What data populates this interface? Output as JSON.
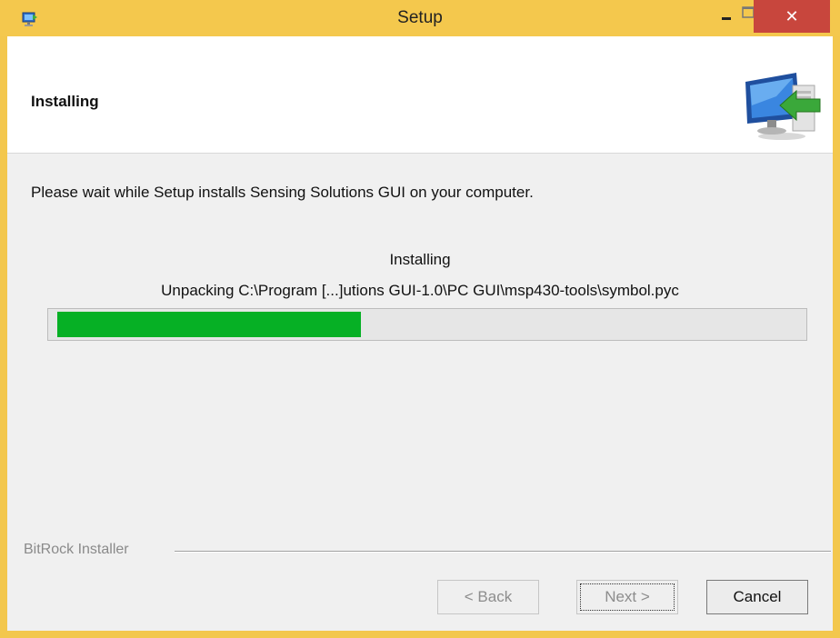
{
  "window": {
    "title": "Setup",
    "app_icon": "installer-app-icon",
    "controls": {
      "minimize": "minimize-icon",
      "maximize": "maximize-icon",
      "close": "close-icon"
    },
    "close_glyph": "✕",
    "colors": {
      "frame": "#f4c84d",
      "close": "#c8463d"
    }
  },
  "header": {
    "title": "Installing",
    "graphic": "computer-install-arrow-icon"
  },
  "body": {
    "description": "Please wait while Setup installs Sensing Solutions GUI on your computer.",
    "status": "Installing",
    "detail": "Unpacking C:\\Program [...]utions GUI-1.0\\PC GUI\\msp430-tools\\symbol.pyc"
  },
  "progress": {
    "percent": 41,
    "color": "#06b025"
  },
  "footer": {
    "brand": "BitRock Installer",
    "buttons": {
      "back": {
        "label": "< Back",
        "enabled": false
      },
      "next": {
        "label": "Next >",
        "enabled": false,
        "focused": true
      },
      "cancel": {
        "label": "Cancel",
        "enabled": true
      }
    }
  }
}
